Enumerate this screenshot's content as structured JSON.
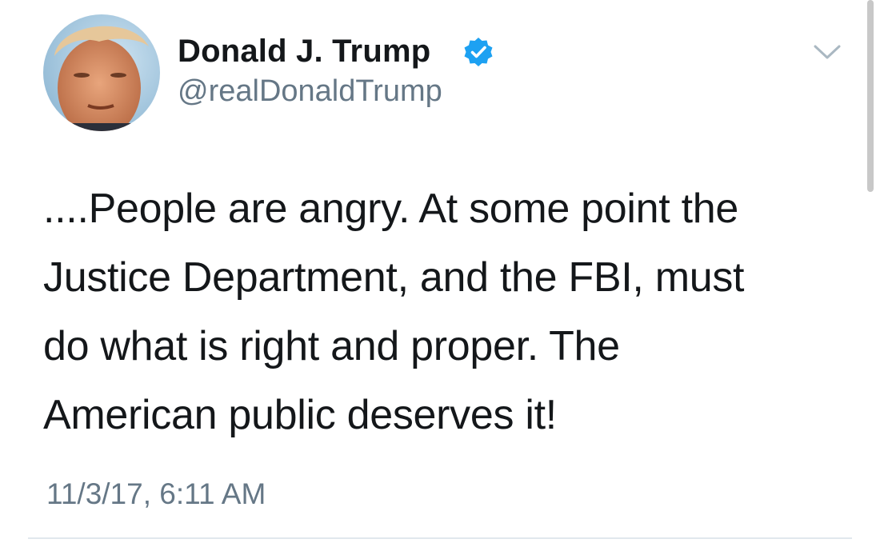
{
  "tweet": {
    "display_name": "Donald J. Trump",
    "handle": "@realDonaldTrump",
    "verified": true,
    "text": "....People are angry.  At some point the\nJustice Department, and the FBI, must\ndo what is right and proper. The\nAmerican public deserves it!",
    "timestamp": "11/3/17, 6:11 AM"
  },
  "icons": {
    "verified": "verified-badge-icon",
    "menu": "chevron-down-icon"
  },
  "colors": {
    "verified_blue": "#1da1f2",
    "secondary_text": "#657786",
    "primary_text": "#14171a",
    "divider": "#e1e8ed"
  }
}
